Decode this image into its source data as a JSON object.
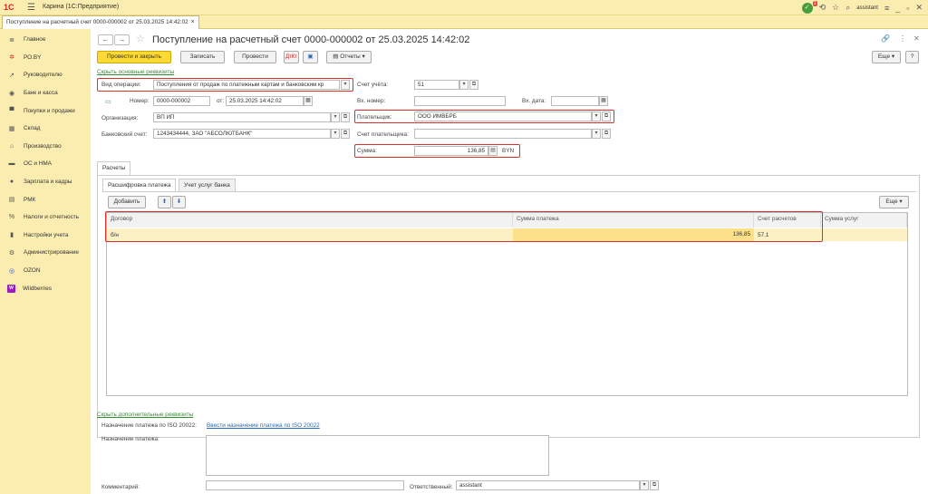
{
  "app": {
    "logo": "1С",
    "title": "Карина  (1С:Предприятие)",
    "user": "assistant",
    "notification_count": "1"
  },
  "doc_tab": {
    "label": "Поступление на расчетный счет 0000-000002 от 25.03.2025 14:42:02"
  },
  "sidebar": {
    "items": [
      {
        "label": "Главное",
        "icon": "menu-icon"
      },
      {
        "label": "РО.BY",
        "icon": "sun-icon"
      },
      {
        "label": "Руководителю",
        "icon": "trend-icon"
      },
      {
        "label": "Банк и касса",
        "icon": "bank-icon"
      },
      {
        "label": "Покупки и продажи",
        "icon": "cart-icon"
      },
      {
        "label": "Склад",
        "icon": "warehouse-icon"
      },
      {
        "label": "Производство",
        "icon": "factory-icon"
      },
      {
        "label": "ОС и НМА",
        "icon": "truck-icon"
      },
      {
        "label": "Зарплата и кадры",
        "icon": "person-icon"
      },
      {
        "label": "РМК",
        "icon": "register-icon"
      },
      {
        "label": "Налоги и отчетность",
        "icon": "tax-icon"
      },
      {
        "label": "Настройки учета",
        "icon": "book-icon"
      },
      {
        "label": "Администрирование",
        "icon": "gear-icon"
      },
      {
        "label": "OZON",
        "icon": "ozon-icon"
      },
      {
        "label": "Wildberries",
        "icon": "wildberries-icon"
      }
    ]
  },
  "form": {
    "title": "Поступление на расчетный счет 0000-000002 от 25.03.2025 14:42:02",
    "toolbar": {
      "post_close": "Провести и закрыть",
      "save": "Записать",
      "post": "Провести",
      "reports": "Отчеты",
      "more": "Еще",
      "help": "?"
    },
    "hide_main_link": "Скрыть основные реквизиты",
    "operation_label": "Вид операции:",
    "operation_value": "Поступления от продаж по платежным картам и банковским кр",
    "account_label": "Счет учёта:",
    "account_value": "51",
    "number_label": "Номер:",
    "number_value": "0000-000002",
    "date_label": "от:",
    "date_value": "25.03.2025 14:42:02",
    "in_number_label": "Вх. номер:",
    "in_number_value": "",
    "in_date_label": "Вх. дата:",
    "in_date_value": "",
    "org_label": "Организация:",
    "org_value": "ВП ИП",
    "payer_label": "Плательщик:",
    "payer_value": "ООО ИМВБРБ",
    "bank_label": "Банковский счет:",
    "bank_value": "1243434444, ЗАО \"АБСОЛЮТБАНК\"",
    "payer_account_label": "Счет плательщика:",
    "payer_account_value": "",
    "sum_label": "Сумма:",
    "sum_value": "136,85",
    "currency": "BYN",
    "outer_tab": "Расчеты",
    "inner_tabs": [
      "Расшифровка платежа",
      "Учет услуг банка"
    ],
    "add_button": "Добавить",
    "table_more": "Еще",
    "columns": [
      "Договор",
      "Сумма платежа",
      "Счет расчетов",
      "Сумма услуг"
    ],
    "rows": [
      {
        "contract": "б/н",
        "amount": "136,85",
        "account": "57.1",
        "service": ""
      }
    ],
    "hide_extra_link": "Скрыть дополнительные реквизиты",
    "iso_label": "Назначение платежа по ISO 20022:",
    "iso_link": "Ввести назначение платежа по ISO 20022",
    "purpose_label": "Назначение платежа:",
    "purpose_value": "",
    "comment_label": "Комментарий:",
    "comment_value": "",
    "responsible_label": "Ответственный:",
    "responsible_value": "assistant"
  },
  "colors": {
    "sidebar_bg": "#fbedb0",
    "primary_button": "#fdd935",
    "highlight_border": "#d9302a",
    "selected_row": "#fbf1c4",
    "link": "#2a6ab4"
  }
}
